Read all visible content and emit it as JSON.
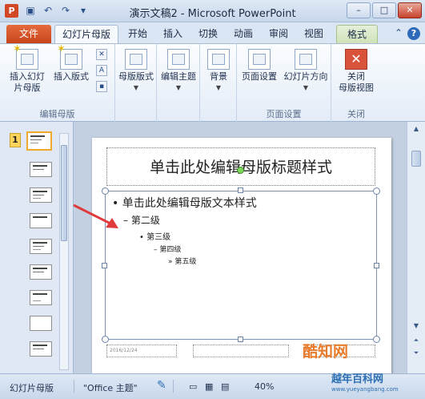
{
  "window": {
    "title": "演示文稿2 - Microsoft PowerPoint",
    "app_icon": "P"
  },
  "tabs": [
    {
      "label": "文件"
    },
    {
      "label": "幻灯片母版"
    },
    {
      "label": "开始"
    },
    {
      "label": "插入"
    },
    {
      "label": "切换"
    },
    {
      "label": "动画"
    },
    {
      "label": "审阅"
    },
    {
      "label": "视图"
    },
    {
      "label": "格式"
    }
  ],
  "ribbon": {
    "groups": [
      {
        "label": "编辑母版"
      },
      {
        "label": ""
      },
      {
        "label": ""
      },
      {
        "label": ""
      },
      {
        "label": "页面设置"
      },
      {
        "label": "关闭"
      }
    ],
    "buttons": {
      "insert_master_1": "插入幻灯",
      "insert_master_2": "片母版",
      "insert_layout": "插入版式",
      "master_layout": "母版版式",
      "edit_theme": "编辑主题",
      "background": "背景",
      "page_setup": "页面设置",
      "orientation": "幻灯片方向",
      "close_1": "关闭",
      "close_2": "母版视图"
    }
  },
  "thumbnails": {
    "selected_number": "1"
  },
  "slide": {
    "title": "单击此处编辑母版标题样式",
    "body": {
      "level1": "单击此处编辑母版文本样式",
      "level2": "第二级",
      "level3": "第三级",
      "level4": "第四级",
      "level5": "第五级"
    },
    "footer_date": "2016/12/24"
  },
  "statusbar": {
    "view": "幻灯片母版",
    "theme": "\"Office 主题\"",
    "zoom": "40%"
  },
  "watermark": {
    "brand": "酷知网",
    "site_cn": "越年百科网",
    "site_url": "www.yueyangbang.com"
  },
  "colors": {
    "file_tab": "#d24726",
    "accent": "#2e6ab9",
    "selected_thumb": "#f0a92c"
  }
}
